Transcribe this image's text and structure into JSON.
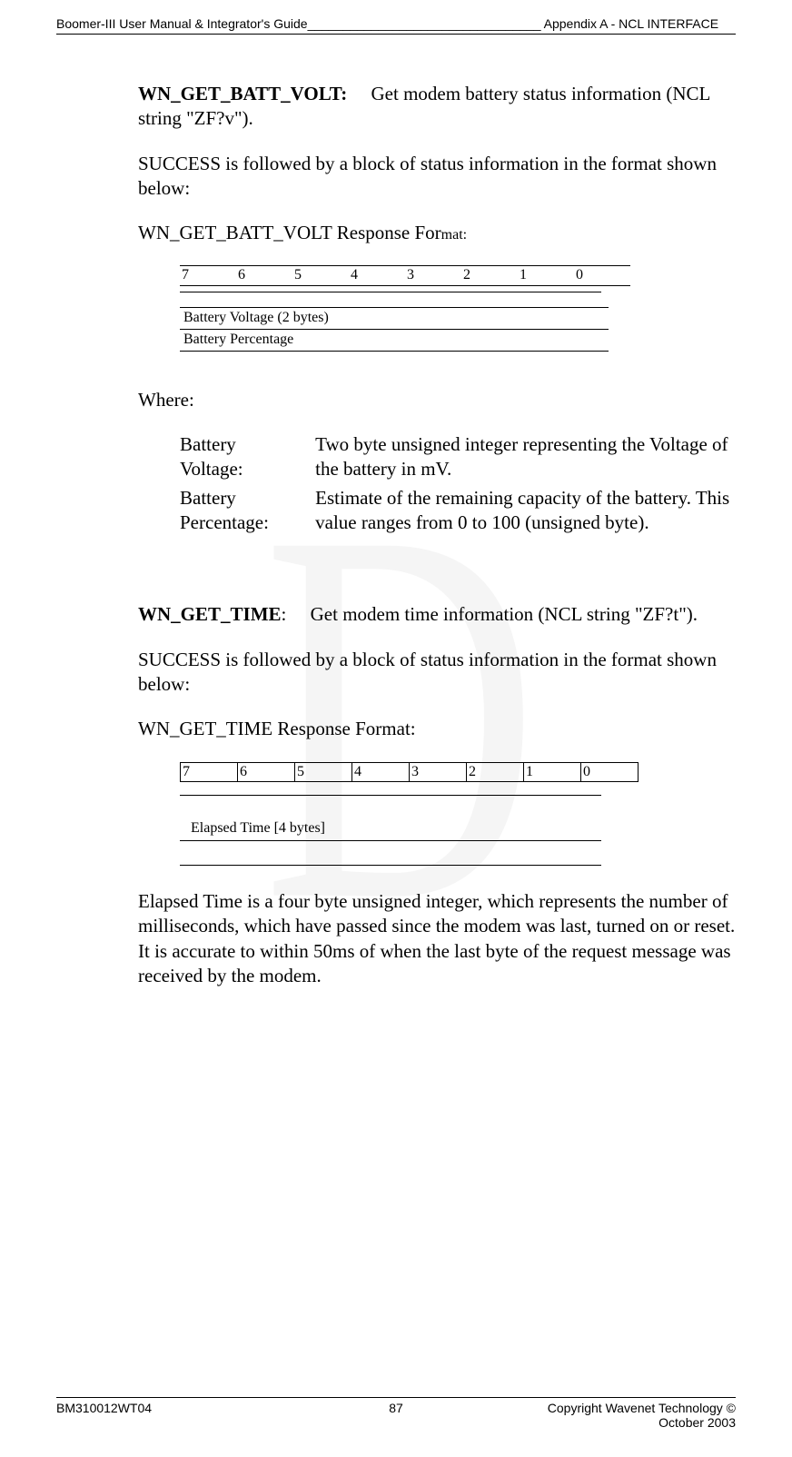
{
  "header": {
    "left": "Boomer-III User Manual & Integrator's Guide_________________________________ Appendix A - NCL INTERFACE"
  },
  "sec1": {
    "title": "WN_GET_BATT_VOLT:",
    "desc": "Get modem battery status information (NCL string \"ZF?v\").",
    "success": "SUCCESS is followed by a block of status information in the format shown below:",
    "resp": "WN_GET_BATT_VOLT Response For",
    "resp_suffix": "mat:"
  },
  "bits1": [
    "7",
    "6",
    "5",
    "4",
    "3",
    "2",
    "1",
    "0"
  ],
  "fields1": {
    "voltage": "Battery Voltage (2 bytes)",
    "percentage": "Battery Percentage"
  },
  "where": "Where:",
  "defs": {
    "voltage_label": "Battery Voltage:",
    "voltage_text": "Two byte unsigned integer representing the Voltage of the battery in mV.",
    "pct_label": "Battery Percentage:",
    "pct_text": "Estimate of the remaining capacity of the battery.  This value ranges from 0 to 100 (unsigned byte)."
  },
  "sec2": {
    "title": "WN_GET_TIME",
    "title_colon": ":",
    "desc": "Get modem time information (NCL string \"ZF?t\").",
    "success": "SUCCESS is followed by a block of status information in the format shown below:",
    "resp": "WN_GET_TIME Response Format:"
  },
  "bits2": [
    "7",
    "6",
    "5",
    "4",
    "3",
    "2",
    "1",
    "0"
  ],
  "fields2": {
    "elapsed": "Elapsed Time [4 bytes]"
  },
  "elapsed_para": "Elapsed Time is a four byte unsigned integer, which represents the number of milliseconds, which have passed since the modem was last, turned on or reset.  It is accurate to within 50ms of when the last byte of the request message was received by the modem.",
  "footer": {
    "left": "BM310012WT04",
    "center": "87",
    "right": "Copyright Wavenet Technology © October 2003"
  }
}
